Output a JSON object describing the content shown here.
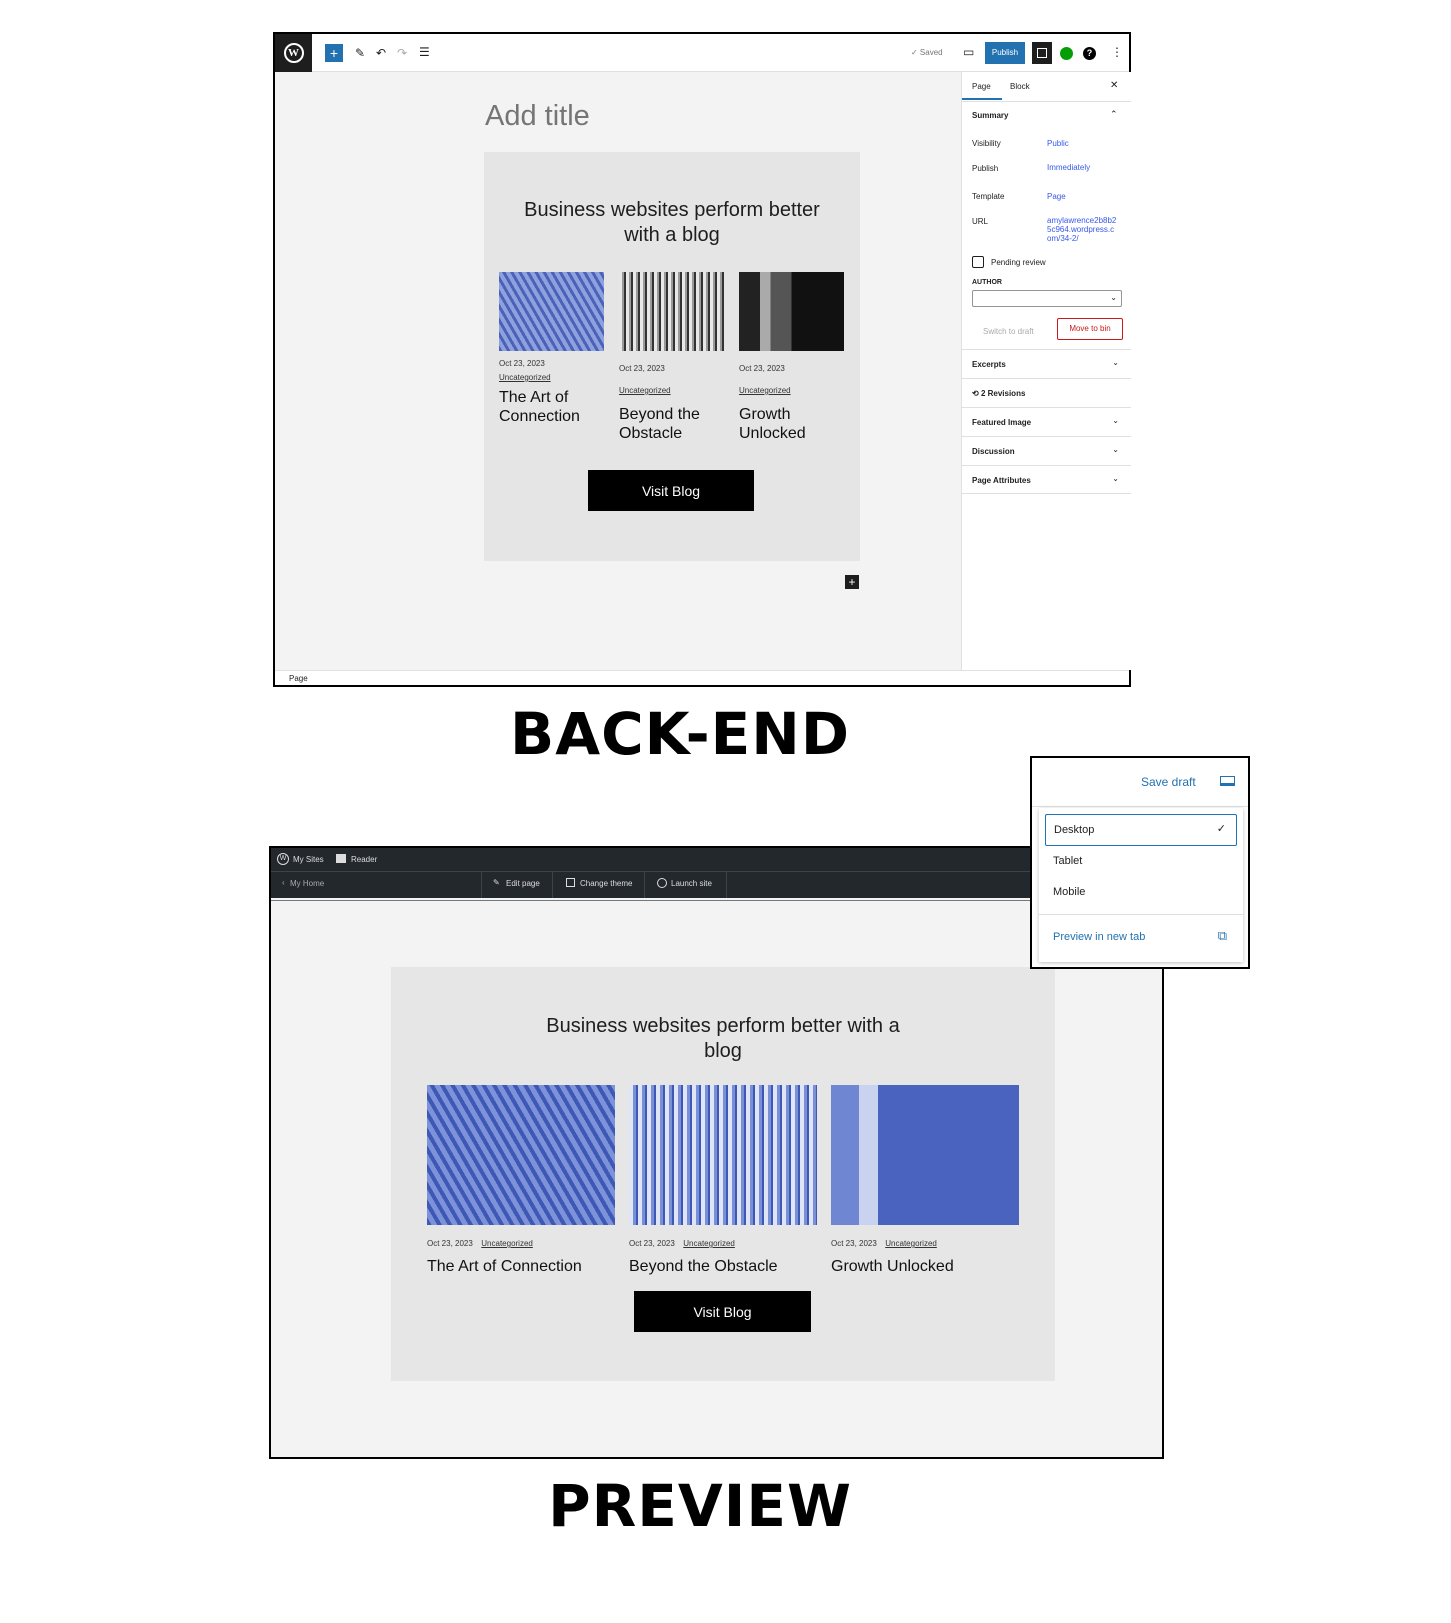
{
  "editor": {
    "toolbar": {
      "saved": "✓ Saved",
      "publish": "Publish"
    },
    "title_placeholder": "Add title",
    "card": {
      "heading": "Business websites perform better with a blog",
      "button": "Visit Blog",
      "posts": [
        {
          "date": "Oct 23, 2023",
          "category": "Uncategorized",
          "title": "The Art of Connection"
        },
        {
          "date": "Oct 23, 2023",
          "category": "Uncategorized",
          "title": "Beyond the Obstacle"
        },
        {
          "date": "Oct 23, 2023",
          "category": "Uncategorized",
          "title": "Growth Unlocked"
        }
      ]
    },
    "sidebar": {
      "tabs": [
        "Page",
        "Block"
      ],
      "summary": "Summary",
      "fields": [
        {
          "label": "Visibility",
          "value": "Public"
        },
        {
          "label": "Publish",
          "value": "Immediately"
        },
        {
          "label": "Template",
          "value": "Page"
        },
        {
          "label": "URL",
          "value": "amylawrence2b8b25c964.wordpress.com/34-2/"
        }
      ],
      "pending": "Pending review",
      "author": "AUTHOR",
      "switch_draft": "Switch to draft",
      "move_bin": "Move to bin",
      "sections": [
        "Excerpts",
        "2 Revisions",
        "Featured Image",
        "Discussion",
        "Page Attributes"
      ]
    },
    "footer": "Page"
  },
  "labels": {
    "backend": "BACK-END",
    "preview": "PREVIEW"
  },
  "preview": {
    "admin": {
      "my_sites": "My Sites",
      "reader": "Reader",
      "my_home": "My Home",
      "edit_page": "Edit page",
      "change_theme": "Change theme",
      "launch_site": "Launch site"
    },
    "card": {
      "heading": "Business websites perform better with a blog",
      "button": "Visit Blog",
      "posts": [
        {
          "date": "Oct 23, 2023",
          "category": "Uncategorized",
          "title": "The Art of Connection"
        },
        {
          "date": "Oct 23, 2023",
          "category": "Uncategorized",
          "title": "Beyond the Obstacle"
        },
        {
          "date": "Oct 23, 2023",
          "category": "Uncategorized",
          "title": "Growth Unlocked"
        }
      ]
    }
  },
  "dropdown": {
    "save_draft": "Save draft",
    "options": [
      "Desktop",
      "Tablet",
      "Mobile"
    ],
    "selected": "Desktop",
    "new_tab": "Preview in new tab"
  },
  "colors": {
    "accent": "#2271b1",
    "danger": "#cc1818",
    "admin_bar": "#23282d"
  }
}
